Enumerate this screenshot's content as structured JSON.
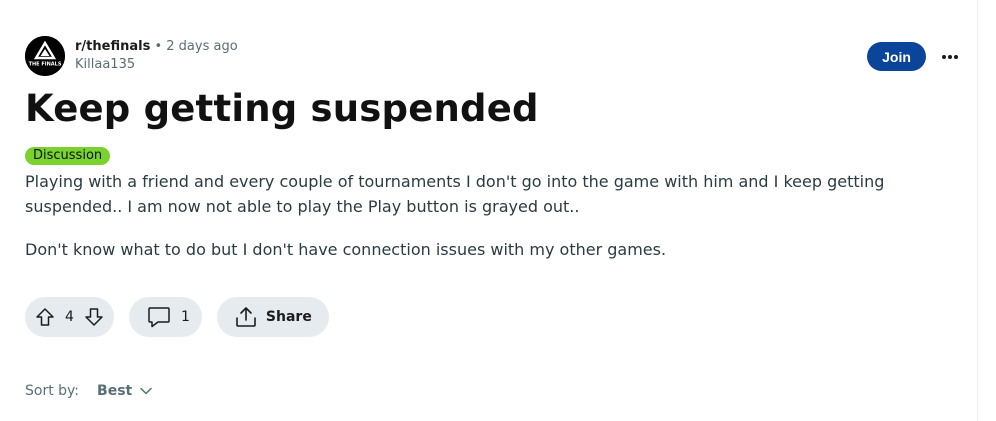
{
  "post": {
    "subreddit": "r/thefinals",
    "separator": "•",
    "time": "2 days ago",
    "author": "Killaa135",
    "join_label": "Join",
    "title": "Keep getting suspended",
    "flair": "Discussion",
    "body": [
      "Playing with a friend and every couple of tournaments I don't go into the game with him and I keep getting suspended.. I am now not able to play the Play button is grayed out..",
      "Don't know what to do but I don't have connection issues with my other games."
    ]
  },
  "actions": {
    "vote_count": "4",
    "comment_count": "1",
    "share_label": "Share"
  },
  "sort": {
    "label": "Sort by:",
    "value": "Best"
  },
  "icons": {
    "avatar": "the-finals-logo",
    "more": "ellipsis-icon",
    "upvote": "arrow-up-icon",
    "downvote": "arrow-down-icon",
    "comment": "speech-bubble-icon",
    "share": "share-upload-icon",
    "sort": "chevron-down-icon"
  },
  "colors": {
    "join_bg": "#0a449b",
    "flair_bg": "#7ad12f",
    "pill_bg": "#e5ebee"
  }
}
